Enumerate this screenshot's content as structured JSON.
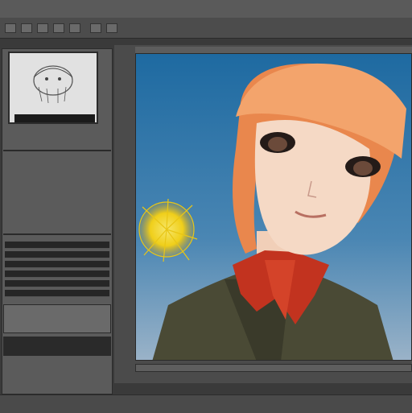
{
  "menubar": {
    "items": [
      "",
      "",
      "",
      "",
      "",
      ""
    ]
  },
  "toolbar": {
    "label": ""
  },
  "left_panel": {
    "navigator_caption": "",
    "info_text": "",
    "layers": [
      "",
      "",
      "",
      "",
      "",
      ""
    ]
  },
  "canvas": {
    "description_colors": {
      "sky_top": "#1e6aa1",
      "sky_bottom": "#8aa9c4",
      "hair": "#e9874d",
      "skin": "#f5d9c5",
      "scarf": "#c2331f",
      "jacket": "#4a4a35",
      "flower": "#f0d11a"
    }
  },
  "statusbar": {
    "text": ""
  }
}
